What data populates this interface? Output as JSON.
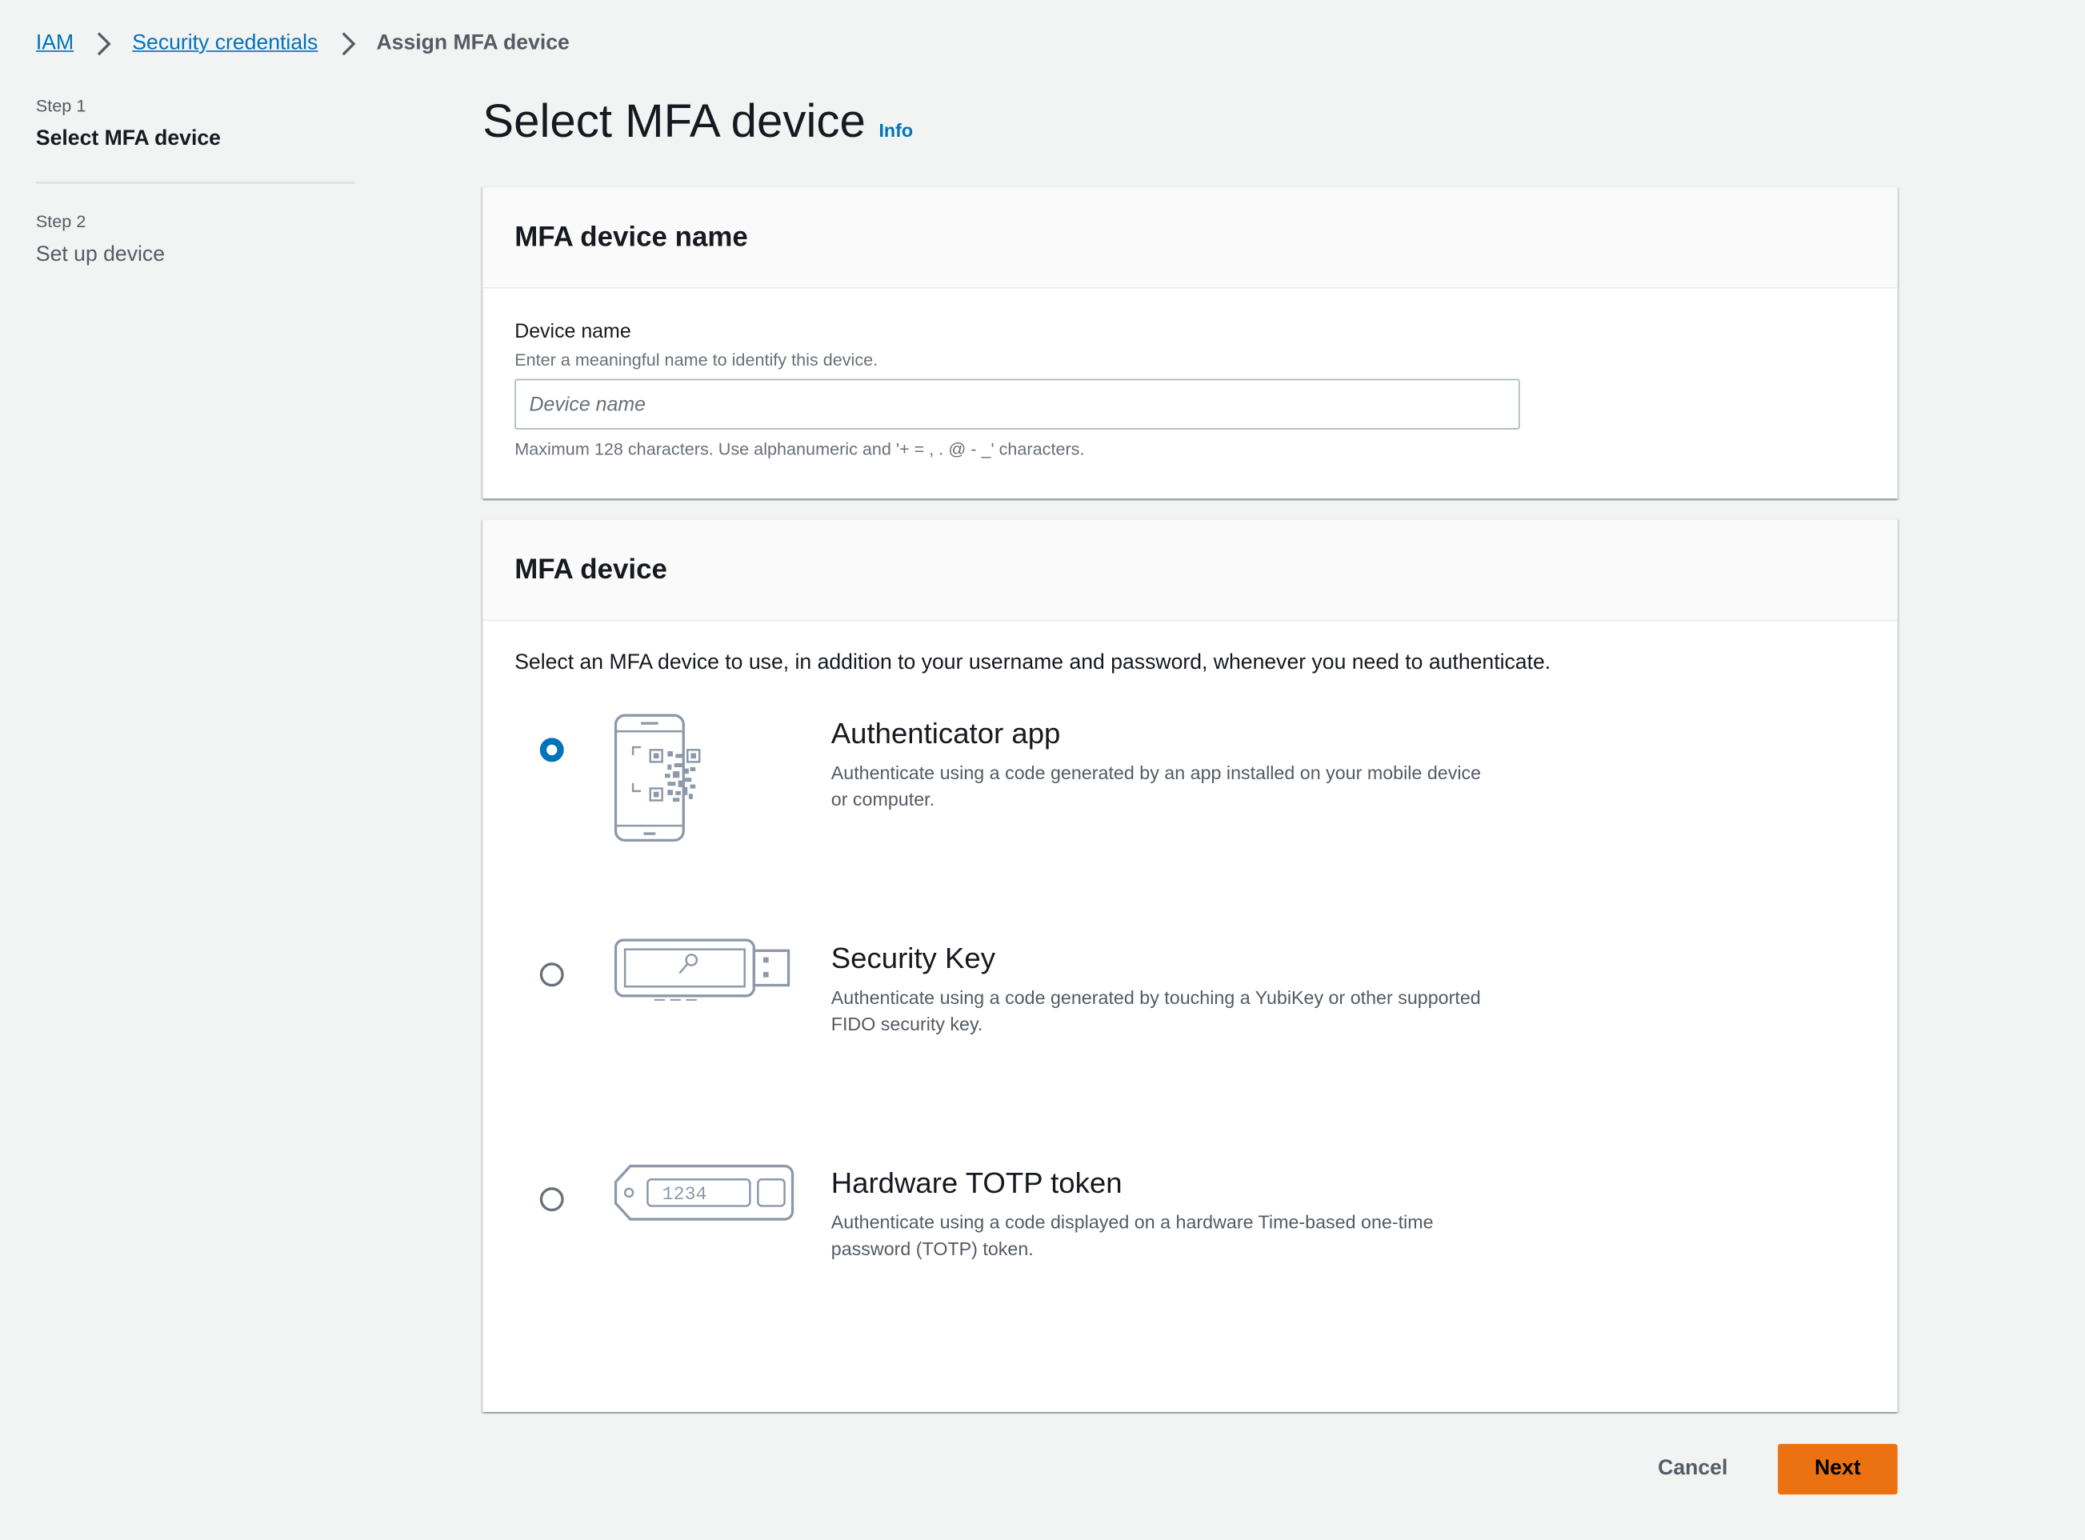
{
  "breadcrumb": {
    "items": [
      {
        "label": "IAM"
      },
      {
        "label": "Security credentials"
      },
      {
        "label": "Assign MFA device"
      }
    ]
  },
  "steps": [
    {
      "number": "Step 1",
      "title": "Select MFA device",
      "active": true
    },
    {
      "number": "Step 2",
      "title": "Set up device",
      "active": false
    }
  ],
  "header": {
    "title": "Select MFA device",
    "info_label": "Info"
  },
  "device_name_panel": {
    "heading": "MFA device name",
    "field_label": "Device name",
    "field_description": "Enter a meaningful name to identify this device.",
    "value": "",
    "placeholder": "Device name",
    "constraint": "Maximum 128 characters. Use alphanumeric and '+ = , . @ - _' characters."
  },
  "mfa_device_panel": {
    "heading": "MFA device",
    "intro": "Select an MFA device to use, in addition to your username and password, whenever you need to authenticate.",
    "options": [
      {
        "title": "Authenticator app",
        "description": "Authenticate using a code generated by an app installed on your mobile device or computer.",
        "selected": true,
        "icon": "phone-qr-icon"
      },
      {
        "title": "Security Key",
        "description": "Authenticate using a code generated by touching a YubiKey or other supported FIDO security key.",
        "selected": false,
        "icon": "usb-security-key-icon"
      },
      {
        "title": "Hardware TOTP token",
        "description": "Authenticate using a code displayed on a hardware Time-based one-time password (TOTP) token.",
        "selected": false,
        "icon": "totp-token-icon",
        "token_display": "1234"
      }
    ]
  },
  "footer": {
    "cancel_label": "Cancel",
    "next_label": "Next"
  },
  "colors": {
    "link": "#0073bb",
    "primary_button": "#ec7211",
    "background": "#f2f3f3"
  }
}
